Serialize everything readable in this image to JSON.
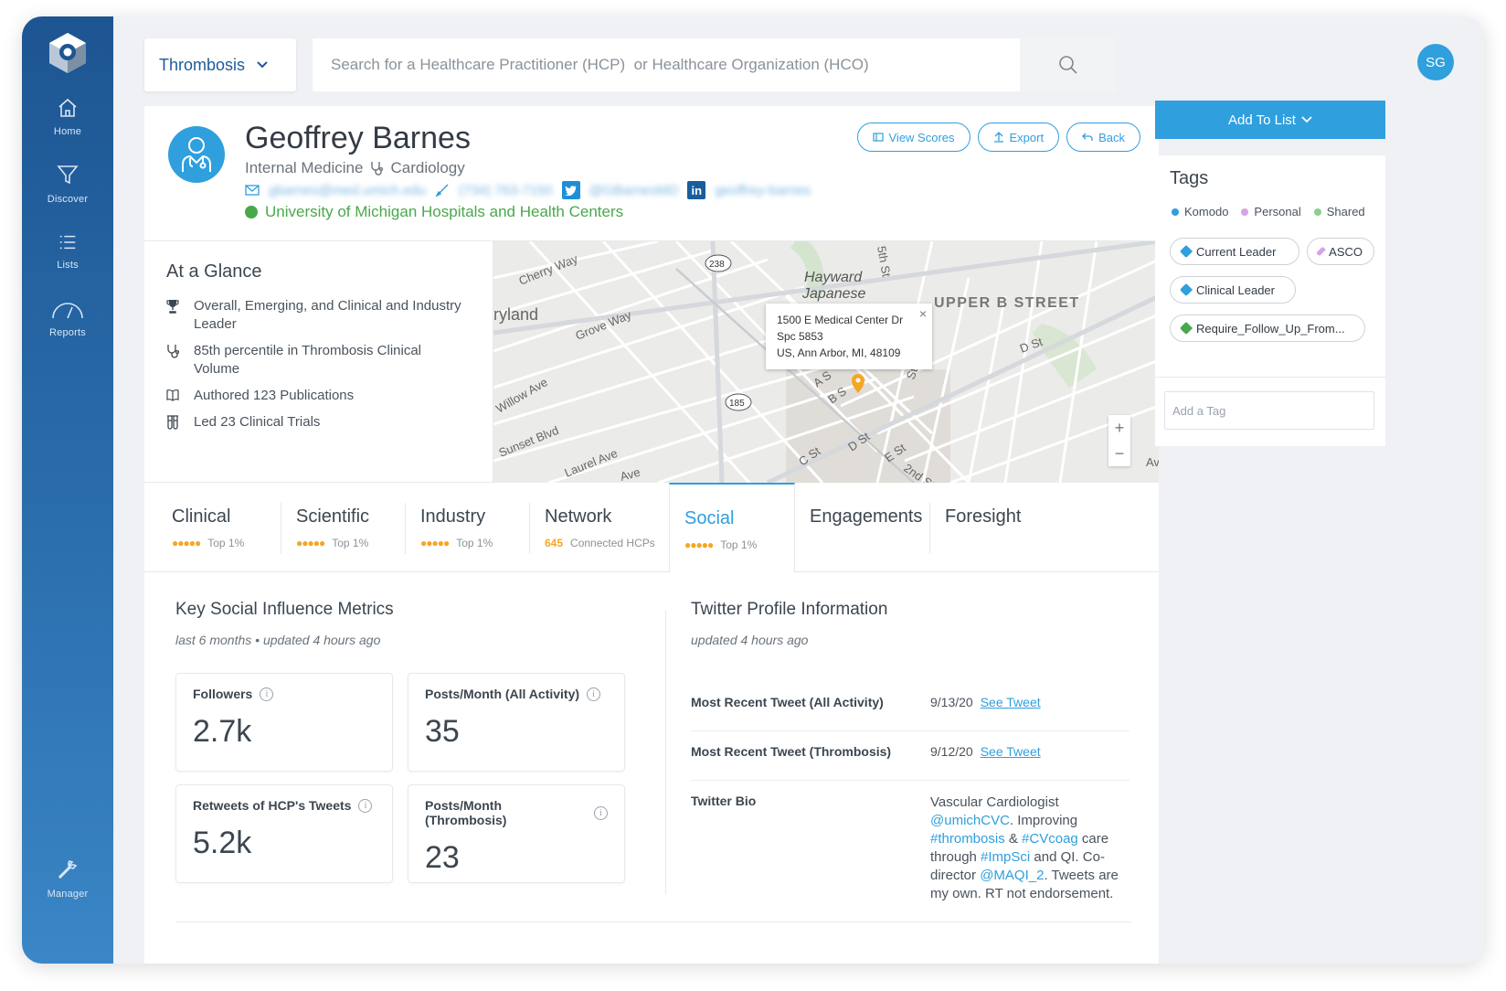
{
  "nav": {
    "items": [
      {
        "label": "Home",
        "icon": "home-icon"
      },
      {
        "label": "Discover",
        "icon": "filter-icon"
      },
      {
        "label": "Lists",
        "icon": "list-icon"
      },
      {
        "label": "Reports",
        "icon": "gauge-icon"
      },
      {
        "label": "Manager",
        "icon": "wrench-icon"
      }
    ]
  },
  "topbar": {
    "topic": "Thrombosis",
    "search_placeholder": "Search for a Healthcare Practitioner (HCP)  or Healthcare Organization (HCO)",
    "user_initials": "SG"
  },
  "profile": {
    "name": "Geoffrey Barnes",
    "specialty_primary": "Internal Medicine",
    "specialty_secondary": "Cardiology",
    "email": "gbarnes@med.umich.edu",
    "phone": "(734) 763-7150",
    "twitter": "@GBarnesMD",
    "linkedin": "geoffrey-barnes",
    "organization": "University of Michigan Hospitals and Health Centers",
    "buttons": {
      "view_scores": "View Scores",
      "export": "Export",
      "back": "Back"
    }
  },
  "glance": {
    "title": "At a Glance",
    "items": [
      {
        "icon": "trophy-icon",
        "text": "Overall, Emerging, and Clinical and Industry Leader"
      },
      {
        "icon": "stethoscope-icon",
        "text": "85th percentile in Thrombosis Clinical Volume"
      },
      {
        "icon": "book-icon",
        "text": "Authored 123 Publications"
      },
      {
        "icon": "test-tubes-icon",
        "text": "Led 23 Clinical Trials"
      }
    ]
  },
  "map": {
    "address_line1": "1500 E Medical Center Dr",
    "address_line2": "Spc 5853",
    "address_line3": "US, Ann Arbor, MI, 48109",
    "labels": {
      "cherry_way": "Cherry Way",
      "hayward": "Hayward",
      "japanese": "Japanese",
      "upper_b": "UPPER B STREET",
      "ryland": "ryland",
      "grove_way": "Grove Way",
      "willow": "Willow Ave",
      "sunset": "Sunset Blvd",
      "laurel": "Laurel Ave",
      "d_st": "D St",
      "c_st": "C St",
      "d_st2": "D St",
      "e_st": "E St",
      "second_st": "2nd St",
      "fifth_st": "5th St",
      "a_s": "A S",
      "b_s": "B S",
      "av": "Av",
      "ave": "Ave",
      "st": "St",
      "rt238": "238",
      "rt185": "185"
    }
  },
  "tabs": [
    {
      "label": "Clinical",
      "rank": "Top 1%",
      "stars": "●●●●●"
    },
    {
      "label": "Scientific",
      "rank": "Top 1%",
      "stars": "●●●●●"
    },
    {
      "label": "Industry",
      "rank": "Top 1%",
      "stars": "●●●●●"
    },
    {
      "label": "Network",
      "count": "645",
      "count_label": "Connected HCPs"
    },
    {
      "label": "Social",
      "rank": "Top 1%",
      "stars": "●●●●●"
    },
    {
      "label": "Engagements"
    },
    {
      "label": "Foresight"
    }
  ],
  "metrics": {
    "title": "Key Social Influence Metrics",
    "subtitle": "last 6 months • updated 4 hours ago",
    "cards": [
      {
        "label": "Followers",
        "value": "2.7k"
      },
      {
        "label": "Posts/Month (All Activity)",
        "value": "35"
      },
      {
        "label": "Retweets of HCP's Tweets",
        "value": "5.2k"
      },
      {
        "label": "Posts/Month (Thrombosis)",
        "value": "23"
      }
    ]
  },
  "twitter": {
    "title": "Twitter Profile Information",
    "subtitle": "updated 4 hours ago",
    "rows": [
      {
        "label": "Most Recent Tweet (All Activity)",
        "date": "9/13/20",
        "link": "See Tweet"
      },
      {
        "label": "Most Recent Tweet (Thrombosis)",
        "date": "9/12/20",
        "link": "See Tweet"
      }
    ],
    "bio_label": "Twitter Bio",
    "bio": {
      "p1": "Vascular Cardiologist ",
      "m1": "@umichCVC",
      "p2": ". Improving ",
      "h1": "#thrombosis",
      "p3": " & ",
      "h2": "#CVcoag",
      "p4": " care through ",
      "h3": "#ImpSci",
      "p5": " and QI. Co-director ",
      "m2": "@MAQI_2",
      "p6": ". Tweets are my own. RT not endorsement."
    }
  },
  "right": {
    "add_to_list": "Add To List",
    "tags_title": "Tags",
    "legend": [
      {
        "label": "Komodo",
        "color": "#2f9fde"
      },
      {
        "label": "Personal",
        "color": "#d7a4e3"
      },
      {
        "label": "Shared",
        "color": "#8ccf8e"
      }
    ],
    "tags": [
      {
        "label": "Current Leader",
        "color": "#2f9fde"
      },
      {
        "label": "ASCO",
        "color": "#d7a4e3"
      },
      {
        "label": "Clinical Leader",
        "color": "#2f9fde"
      },
      {
        "label": "Require_Follow_Up_From...",
        "color": "#49a84c"
      }
    ],
    "add_tag_placeholder": "Add a Tag"
  },
  "colors": {
    "accent": "#2f9fde",
    "sidebar": "#1d5592",
    "org_green": "#49a84c",
    "stars": "#f5a623"
  }
}
